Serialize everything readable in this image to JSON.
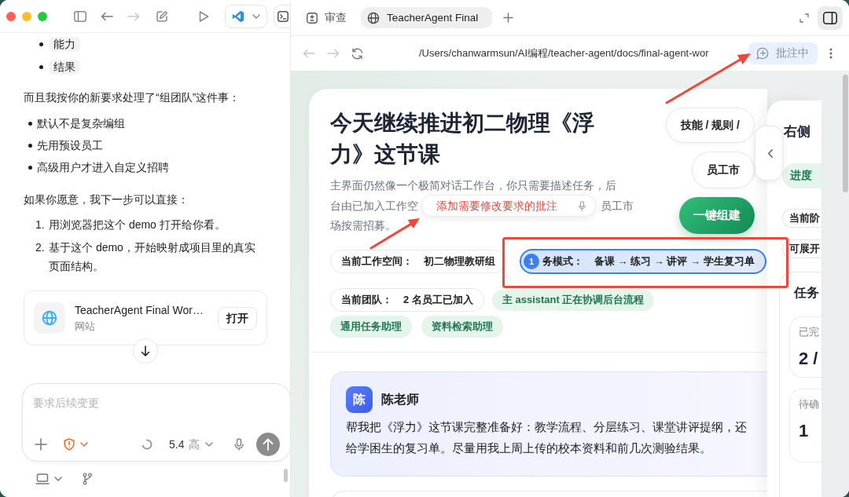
{
  "chat_toolbar": {
    "back_disabled": false,
    "forward_disabled": true
  },
  "chat": {
    "sub_items": [
      "能力",
      "结果"
    ],
    "intro": "而且我按你的新要求处理了“组团队”这件事：",
    "bullets": [
      "默认不是复杂编组",
      "先用预设员工",
      "高级用户才进入自定义招聘"
    ],
    "next": "如果你愿意，我下一步可以直接：",
    "steps": [
      {
        "number": "1.",
        "text": "用浏览器把这个 demo 打开给你看。"
      },
      {
        "number": "2.",
        "text": "基于这个 demo，开始映射成项目里的真实页面结构。"
      }
    ],
    "link_card": {
      "title": "TeacherAgent Final Wor…",
      "subtitle": "网站",
      "button": "打开"
    }
  },
  "composer": {
    "placeholder": "要求后续变更",
    "model": "5.4",
    "effort": "高"
  },
  "browser": {
    "tabs": [
      {
        "kind": "review",
        "label": "审查",
        "selected": false
      },
      {
        "kind": "page",
        "label": "TeacherAgent Final",
        "selected": true
      }
    ],
    "back_disabled": true,
    "forward_disabled": true,
    "url": "/Users/chanwarmsun/AI编程/teacher-agent/docs/final-agent-wor",
    "annotate_button": {
      "label": "批注中",
      "on": true
    }
  },
  "page": {
    "title": "今天继续推进初二物理《浮力》这节课",
    "intro": {
      "line_1": "主界面仍然像一个极简对话工作台，你只需要描述任务，后",
      "line_2_start": "台由已加入工作空",
      "line_2_end": "员工市",
      "line_3": "场按需招募。"
    },
    "annotation_input": {
      "value": "添加需要修改要求的批注"
    },
    "actions": [
      {
        "kind": "secondary",
        "label": "技能 / 规则 /"
      },
      {
        "kind": "secondary",
        "label": "员工市"
      },
      {
        "kind": "primary",
        "label": "一键组建"
      }
    ],
    "status_rows": [
      [
        {
          "kind": "chip",
          "label": "当前工作空间：",
          "value": "初二物理教研组",
          "highlighted": false
        },
        {
          "kind": "chip",
          "label": "务模式：",
          "value": "备课 → 练习 → 讲评 → 学生复习单",
          "highlighted": true,
          "badge": "1"
        }
      ],
      [
        {
          "kind": "chip",
          "label": "当前团队：",
          "value": "2 名员工已加入",
          "highlighted": false
        },
        {
          "kind": "tag",
          "label": "主 assistant 正在协调后台流程"
        }
      ],
      [
        {
          "kind": "tag",
          "label": "通用任务助理"
        },
        {
          "kind": "tag",
          "label": "资料检索助理"
        }
      ]
    ],
    "message": {
      "avatar": "陈",
      "author": "陈老师",
      "lines": [
        "帮我把《浮力》这节课完整准备好：教学流程、分层练习、课堂讲评提纲，还",
        "给学困生的复习单。尽量用我上周上传的校本资料和前几次测验结果。"
      ]
    }
  },
  "side_panel": {
    "title": "右侧",
    "pills": [
      {
        "kind": "tag",
        "label": "进度"
      },
      {
        "kind": "chip",
        "label": "当前阶"
      },
      {
        "kind": "chip",
        "label": "可展开"
      }
    ],
    "summary": {
      "title": "任务",
      "stats": [
        {
          "label": "已完",
          "value": "2 /"
        },
        {
          "label": "待确",
          "value": "1"
        }
      ]
    }
  }
}
